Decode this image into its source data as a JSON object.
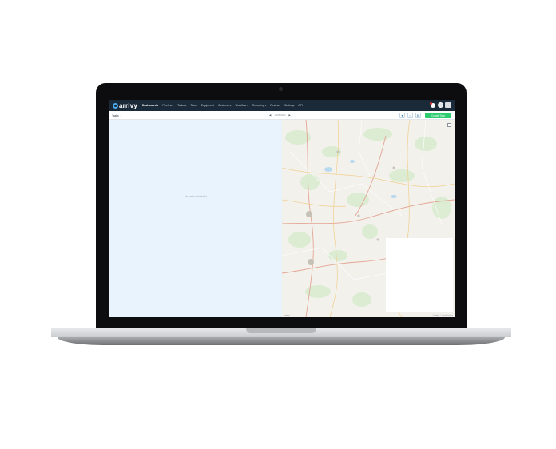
{
  "nav": {
    "logo": "arrivy",
    "items": [
      {
        "label": "Dashboard ▾",
        "active": true
      },
      {
        "label": "Pipelines",
        "active": false
      },
      {
        "label": "Tasks ▾",
        "active": false
      },
      {
        "label": "Team",
        "active": false
      },
      {
        "label": "Equipment",
        "active": false
      },
      {
        "label": "Customers",
        "active": false
      },
      {
        "label": "Workflow ▾",
        "active": false
      },
      {
        "label": "Reporting ▾",
        "active": false
      },
      {
        "label": "Reviews",
        "active": false
      },
      {
        "label": "Settings",
        "active": false
      },
      {
        "label": "API",
        "active": false
      }
    ]
  },
  "toolbar": {
    "tasks_label": "Tasks",
    "date": "10/26/2023",
    "create_label": "Create Task"
  },
  "task_panel": {
    "empty_message": "No tasks scheduled"
  },
  "map": {
    "attribution": "© Mapbox © OpenStreetMap",
    "logo": "mapbox"
  },
  "colors": {
    "nav_bg": "#1b2a39",
    "accent": "#48a8ea",
    "create_button": "#2ecc71",
    "task_panel_bg": "#e9f3fd"
  }
}
